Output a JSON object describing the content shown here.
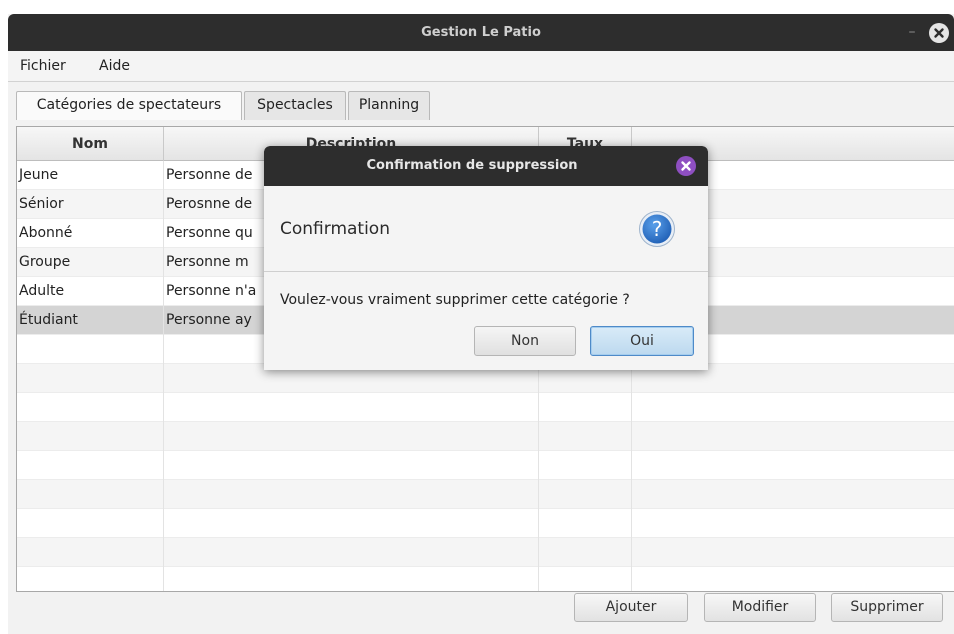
{
  "window": {
    "title": "Gestion Le Patio",
    "minimize_glyph": "–"
  },
  "menubar": {
    "items": [
      "Fichier",
      "Aide"
    ]
  },
  "tabs": [
    {
      "label": "Catégories de spectateurs",
      "active": true
    },
    {
      "label": "Spectacles",
      "active": false
    },
    {
      "label": "Planning",
      "active": false
    }
  ],
  "table": {
    "columns": [
      "Nom",
      "Description",
      "Taux",
      ""
    ],
    "rows": [
      {
        "nom": "Jeune",
        "description": "Personne de"
      },
      {
        "nom": "Sénior",
        "description": "Perosnne de"
      },
      {
        "nom": "Abonné",
        "description": "Personne qu"
      },
      {
        "nom": "Groupe",
        "description": "Personne m"
      },
      {
        "nom": "Adulte",
        "description": "Personne n'a"
      },
      {
        "nom": "Étudiant",
        "description": "Personne ay",
        "selected": true
      }
    ]
  },
  "buttons": {
    "add": "Ajouter",
    "edit": "Modifier",
    "delete": "Supprimer"
  },
  "dialog": {
    "title": "Confirmation de suppression",
    "heading": "Confirmation",
    "message": "Voulez-vous vraiment supprimer cette catégorie ?",
    "cancel": "Non",
    "ok": "Oui",
    "icon": "question-icon"
  },
  "colors": {
    "titlebar": "#2d2d2d",
    "dialog_close": "#8e4fc1",
    "question_icon": "#2f78d0",
    "selected_row": "#d4d4d4"
  }
}
